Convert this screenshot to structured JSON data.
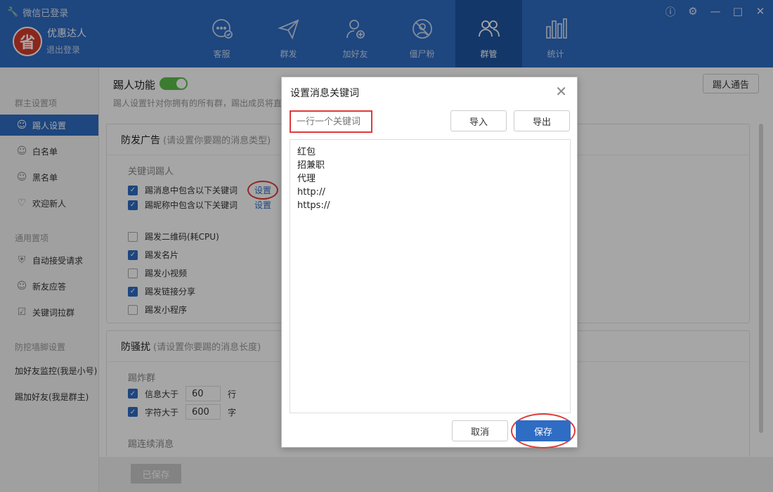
{
  "header": {
    "status": "微信已登录",
    "avatar_char": "省",
    "user_name": "优惠达人",
    "logout": "退出登录",
    "nav": [
      {
        "label": "客服",
        "icon": "chat-icon"
      },
      {
        "label": "群发",
        "icon": "send-icon"
      },
      {
        "label": "加好友",
        "icon": "add-friend-icon"
      },
      {
        "label": "僵尸粉",
        "icon": "zombie-fans-icon"
      },
      {
        "label": "群管",
        "icon": "group-manage-icon"
      },
      {
        "label": "统计",
        "icon": "stats-icon"
      }
    ],
    "active_nav": "群管"
  },
  "sidebar": {
    "group1": "群主设置项",
    "items1": [
      {
        "label": "踢人设置",
        "icon": "user-kick-icon"
      },
      {
        "label": "白名单",
        "icon": "whitelist-icon"
      },
      {
        "label": "黑名单",
        "icon": "blacklist-icon"
      },
      {
        "label": "欢迎新人",
        "icon": "heart-icon"
      }
    ],
    "group2": "通用置项",
    "items2": [
      {
        "label": "自动接受请求",
        "icon": "shield-icon"
      },
      {
        "label": "新友应答",
        "icon": "reply-icon"
      },
      {
        "label": "关键词拉群",
        "icon": "keyword-group-icon"
      }
    ],
    "group3": "防挖墙脚设置",
    "items3": [
      "加好友监控(我是小号)",
      "踢加好友(我是群主)"
    ]
  },
  "main": {
    "kick_title": "踢人功能",
    "kick_desc": "踢人设置针对你拥有的所有群，踢出成员将直",
    "notice_button": "踢人通告",
    "ad_panel": {
      "title": "防发广告",
      "hint": "(请设置你要踢的消息类型)",
      "keyword_label": "关键词踢人",
      "rows": [
        {
          "label": "踢消息中包含以下关键词",
          "checked": true,
          "link": "设置"
        },
        {
          "label": "踢昵称中包含以下关键词",
          "checked": true,
          "link": "设置"
        },
        {
          "label": "踢发二维码(耗CPU)",
          "checked": false
        },
        {
          "label": "踢发名片",
          "checked": true
        },
        {
          "label": "踢发小视频",
          "checked": false
        },
        {
          "label": "踢发链接分享",
          "checked": true
        },
        {
          "label": "踢发小程序",
          "checked": false
        }
      ]
    },
    "spam_panel": {
      "title": "防骚扰",
      "hint": "(请设置你要踢的消息长度)",
      "bomb_label": "踢炸群",
      "rows": [
        {
          "label": "信息大于",
          "value": "60",
          "unit": "行",
          "checked": true
        },
        {
          "label": "字符大于",
          "value": "600",
          "unit": "字",
          "checked": true
        }
      ],
      "continuous_label": "踢连续消息"
    },
    "saved_button": "已保存"
  },
  "dialog": {
    "title": "设置消息关键词",
    "placeholder": "一行一个关键词",
    "import": "导入",
    "export": "导出",
    "keywords": [
      "红包",
      "招兼职",
      "代理",
      "http://",
      "https://"
    ],
    "cancel": "取消",
    "save": "保存"
  }
}
